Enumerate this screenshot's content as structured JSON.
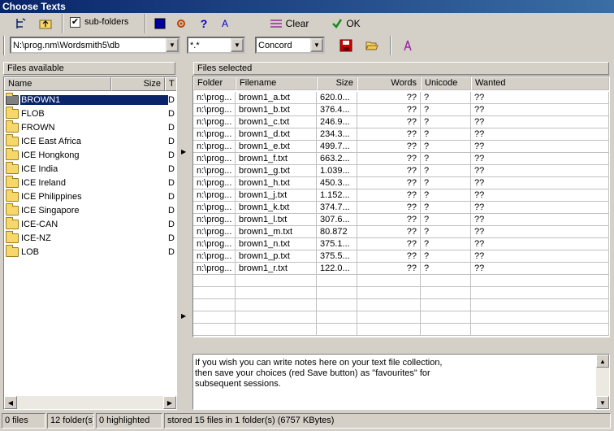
{
  "window": {
    "title": "Choose Texts"
  },
  "toolbar": {
    "subfolders_label": "sub-folders",
    "subfolders_checked": true,
    "clear_label": "Clear",
    "ok_label": "OK",
    "help_label": "?",
    "font_label": "A"
  },
  "path_combo": {
    "value": "N:\\prog.nm\\Wordsmith5\\db"
  },
  "filter_combo": {
    "value": "*.*"
  },
  "tool_combo": {
    "value": "Concord"
  },
  "left_panel": {
    "header": "Files available",
    "columns": {
      "name": "Name",
      "size": "Size",
      "type": "T"
    },
    "folders": [
      {
        "name": "BROWN1",
        "type": "D",
        "selected": true
      },
      {
        "name": "FLOB",
        "type": "D"
      },
      {
        "name": "FROWN",
        "type": "D"
      },
      {
        "name": "ICE East Africa",
        "type": "D"
      },
      {
        "name": "ICE Hongkong",
        "type": "D"
      },
      {
        "name": "ICE India",
        "type": "D"
      },
      {
        "name": "ICE Ireland",
        "type": "D"
      },
      {
        "name": "ICE Philippines",
        "type": "D"
      },
      {
        "name": "ICE Singapore",
        "type": "D"
      },
      {
        "name": "ICE-CAN",
        "type": "D"
      },
      {
        "name": "ICE-NZ",
        "type": "D"
      },
      {
        "name": "LOB",
        "type": "D"
      }
    ]
  },
  "right_panel": {
    "header": "Files selected",
    "columns": {
      "folder": "Folder",
      "filename": "Filename",
      "size": "Size",
      "words": "Words",
      "unicode": "Unicode",
      "wanted": "Wanted"
    },
    "rows": [
      {
        "folder": "n:\\prog...",
        "filename": "brown1_a.txt",
        "size": "620.0...",
        "words": "??",
        "unicode": "?",
        "wanted": "??"
      },
      {
        "folder": "n:\\prog...",
        "filename": "brown1_b.txt",
        "size": "376.4...",
        "words": "??",
        "unicode": "?",
        "wanted": "??"
      },
      {
        "folder": "n:\\prog...",
        "filename": "brown1_c.txt",
        "size": "246.9...",
        "words": "??",
        "unicode": "?",
        "wanted": "??"
      },
      {
        "folder": "n:\\prog...",
        "filename": "brown1_d.txt",
        "size": "234.3...",
        "words": "??",
        "unicode": "?",
        "wanted": "??"
      },
      {
        "folder": "n:\\prog...",
        "filename": "brown1_e.txt",
        "size": "499.7...",
        "words": "??",
        "unicode": "?",
        "wanted": "??"
      },
      {
        "folder": "n:\\prog...",
        "filename": "brown1_f.txt",
        "size": "663.2...",
        "words": "??",
        "unicode": "?",
        "wanted": "??"
      },
      {
        "folder": "n:\\prog...",
        "filename": "brown1_g.txt",
        "size": "1.039...",
        "words": "??",
        "unicode": "?",
        "wanted": "??"
      },
      {
        "folder": "n:\\prog...",
        "filename": "brown1_h.txt",
        "size": "450.3...",
        "words": "??",
        "unicode": "?",
        "wanted": "??"
      },
      {
        "folder": "n:\\prog...",
        "filename": "brown1_j.txt",
        "size": "1.152...",
        "words": "??",
        "unicode": "?",
        "wanted": "??"
      },
      {
        "folder": "n:\\prog...",
        "filename": "brown1_k.txt",
        "size": "374.7...",
        "words": "??",
        "unicode": "?",
        "wanted": "??"
      },
      {
        "folder": "n:\\prog...",
        "filename": "brown1_l.txt",
        "size": "307.6...",
        "words": "??",
        "unicode": "?",
        "wanted": "??"
      },
      {
        "folder": "n:\\prog...",
        "filename": "brown1_m.txt",
        "size": "80.872",
        "words": "??",
        "unicode": "?",
        "wanted": "??"
      },
      {
        "folder": "n:\\prog...",
        "filename": "brown1_n.txt",
        "size": "375.1...",
        "words": "??",
        "unicode": "?",
        "wanted": "??"
      },
      {
        "folder": "n:\\prog...",
        "filename": "brown1_p.txt",
        "size": "375.5...",
        "words": "??",
        "unicode": "?",
        "wanted": "??"
      },
      {
        "folder": "n:\\prog...",
        "filename": "brown1_r.txt",
        "size": "122.0...",
        "words": "??",
        "unicode": "?",
        "wanted": "??"
      }
    ]
  },
  "notes": {
    "line1": "If you wish you can write notes here on your text file collection,",
    "line2": "then save your choices (red Save button) as \"favourites\" for",
    "line3": "subsequent sessions."
  },
  "statusbar": {
    "files": "0 files",
    "folders": "12 folder(s)",
    "highlighted": "0 highlighted",
    "stored": "stored 15 files in 1 folder(s) (6757 KBytes)"
  },
  "colors": {
    "selection": "#0a246a",
    "save_icon": "#cc0000",
    "clear_icon": "#9a2aa0",
    "ok_icon": "#1a8a1a"
  }
}
